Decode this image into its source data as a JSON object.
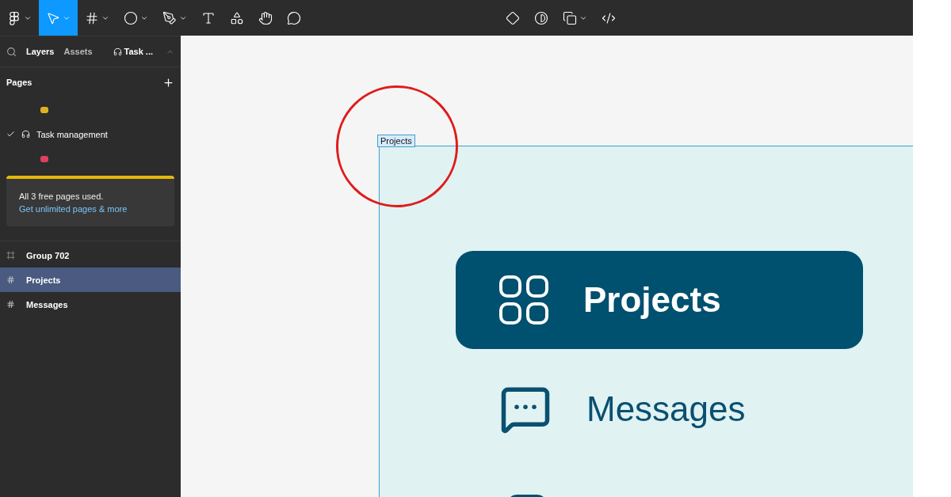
{
  "toolbar": {
    "tools": [
      {
        "kind": "logo",
        "selected": false,
        "menu": true
      },
      {
        "kind": "move",
        "selected": true,
        "menu": true
      },
      {
        "kind": "frame",
        "selected": false,
        "menu": true
      },
      {
        "kind": "shape",
        "selected": false,
        "menu": true
      },
      {
        "kind": "pen",
        "selected": false,
        "menu": true
      },
      {
        "kind": "text",
        "selected": false,
        "menu": false
      },
      {
        "kind": "resources",
        "selected": false,
        "menu": false
      },
      {
        "kind": "hand",
        "selected": false,
        "menu": false
      },
      {
        "kind": "comment",
        "selected": false,
        "menu": false
      }
    ],
    "center_tools": [
      {
        "kind": "component",
        "menu": false
      },
      {
        "kind": "contrast",
        "menu": false
      },
      {
        "kind": "boolean",
        "menu": true
      },
      {
        "kind": "devmode",
        "menu": false
      }
    ]
  },
  "sidebar": {
    "tabs": [
      {
        "label": "Layers",
        "selected": true
      },
      {
        "label": "Assets",
        "selected": false
      }
    ],
    "file_name": "Task ...",
    "pages_title": "Pages",
    "pages": [
      {
        "kind": "emoji",
        "selected": false,
        "color": "#e0b020"
      },
      {
        "kind": "text",
        "label": "Task management",
        "selected": true
      },
      {
        "kind": "emoji",
        "selected": false,
        "color": "#e04060"
      }
    ],
    "notice": {
      "text": "All 3 free pages used.",
      "link": "Get unlimited pages & more"
    },
    "layers": [
      {
        "kind": "group",
        "label": "Group 702",
        "selected": false
      },
      {
        "kind": "frame",
        "label": "Projects",
        "selected": true
      },
      {
        "kind": "frame",
        "label": "Messages",
        "selected": false
      }
    ]
  },
  "canvas": {
    "frame_label": "Projects",
    "nav": [
      {
        "kind": "grid",
        "label": "Projects",
        "selected": true
      },
      {
        "kind": "chat",
        "label": "Messages",
        "selected": false
      },
      {
        "kind": "cut",
        "selected": false
      }
    ]
  }
}
